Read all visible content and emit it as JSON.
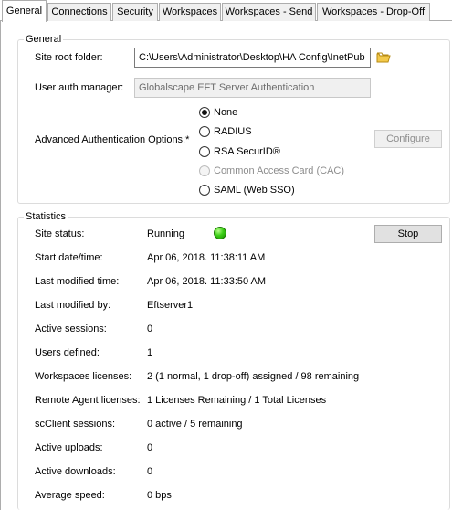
{
  "tabs": [
    "General",
    "Connections",
    "Security",
    "Workspaces",
    "Workspaces - Send",
    "Workspaces - Drop-Off"
  ],
  "general": {
    "legend": "General",
    "site_root_label": "Site root folder:",
    "site_root_value": "C:\\Users\\Administrator\\Desktop\\HA Config\\InetPub",
    "user_auth_label": "User auth manager:",
    "user_auth_value": "Globalscape EFT Server Authentication",
    "adv_auth_label": "Advanced Authentication Options:*",
    "auth_options": [
      {
        "label": "None",
        "checked": true,
        "disabled": false
      },
      {
        "label": "RADIUS",
        "checked": false,
        "disabled": false
      },
      {
        "label": "RSA SecurID®",
        "checked": false,
        "disabled": false
      },
      {
        "label": "Common Access Card (CAC)",
        "checked": false,
        "disabled": true
      },
      {
        "label": "SAML (Web SSO)",
        "checked": false,
        "disabled": false
      }
    ],
    "configure_label": "Configure"
  },
  "statistics": {
    "legend": "Statistics",
    "stop_label": "Stop",
    "status_color": "#3ccf17",
    "rows": [
      {
        "label": "Site status:",
        "value": "Running"
      },
      {
        "label": "Start date/time:",
        "value": "Apr 06, 2018. 11:38:11 AM"
      },
      {
        "label": "Last modified time:",
        "value": "Apr 06, 2018. 11:33:50 AM"
      },
      {
        "label": "Last modified by:",
        "value": "Eftserver1"
      },
      {
        "label": "Active sessions:",
        "value": "0"
      },
      {
        "label": "Users defined:",
        "value": "1"
      },
      {
        "label": "Workspaces licenses:",
        "value": "2 (1 normal, 1 drop-off) assigned / 98 remaining"
      },
      {
        "label": "Remote Agent licenses:",
        "value": "1 Licenses Remaining / 1 Total Licenses"
      },
      {
        "label": "scClient sessions:",
        "value": "0 active / 5 remaining"
      },
      {
        "label": "Active uploads:",
        "value": "0"
      },
      {
        "label": "Active downloads:",
        "value": "0"
      },
      {
        "label": "Average speed:",
        "value": "0 bps"
      }
    ]
  }
}
